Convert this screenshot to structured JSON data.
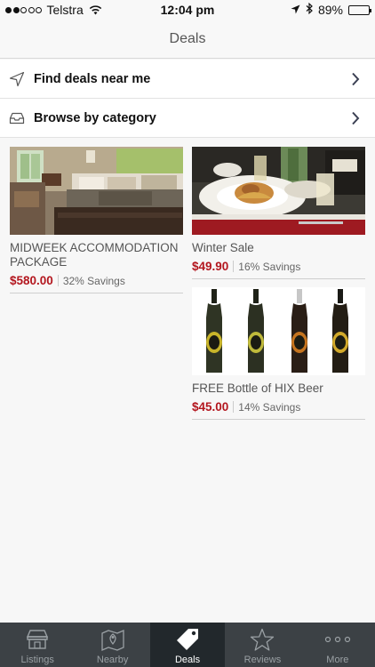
{
  "status_bar": {
    "carrier": "Telstra",
    "time": "12:04 pm",
    "battery": "89%",
    "battery_level": 0.89,
    "signal_bars_filled": 2,
    "signal_bars_total": 5
  },
  "nav": {
    "title": "Deals"
  },
  "menu": {
    "find_label": "Find deals near me",
    "browse_label": "Browse by category"
  },
  "deals": [
    {
      "title": "MIDWEEK ACCOMMODATION PACKAGE",
      "price": "$580.00",
      "savings": "32% Savings",
      "image": "bedroom"
    },
    {
      "title": "Winter Sale",
      "price": "$49.90",
      "savings": "16% Savings",
      "image": "dining"
    },
    {
      "title": "FREE Bottle of HIX Beer",
      "price": "$45.00",
      "savings": "14% Savings",
      "image": "beer-bottles"
    }
  ],
  "tabs": [
    {
      "label": "Listings",
      "icon": "store-icon",
      "active": false
    },
    {
      "label": "Nearby",
      "icon": "map-pin-icon",
      "active": false
    },
    {
      "label": "Deals",
      "icon": "tag-icon",
      "active": true
    },
    {
      "label": "Reviews",
      "icon": "star-icon",
      "active": false
    },
    {
      "label": "More",
      "icon": "more-dots-icon",
      "active": false
    }
  ],
  "colors": {
    "accent_price": "#b3161e",
    "tab_bar": "#3c4145",
    "tab_active": "#22282c"
  }
}
